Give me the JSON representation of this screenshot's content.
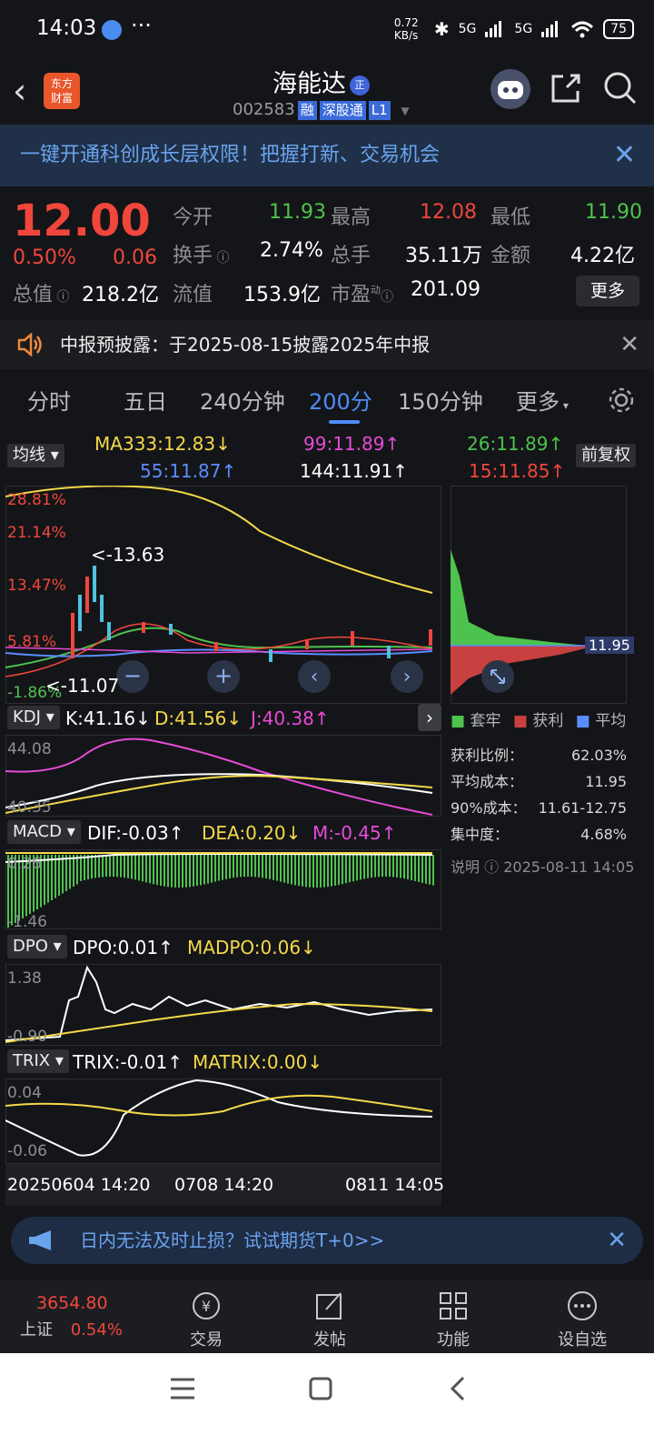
{
  "status": {
    "time": "14:03",
    "dots": "···",
    "net": "0.72 KB/s",
    "sig1": "5G",
    "sig2": "5G",
    "battery": "75"
  },
  "header": {
    "back": "‹",
    "logo_l1": "东方",
    "logo_l2": "财富",
    "name": "海能达",
    "badge": "正",
    "code": "002583",
    "tags": [
      "融",
      "深股通",
      "L1"
    ]
  },
  "banner": {
    "text": "一键开通科创成长层权限！把握打新、交易机会",
    "close": "✕"
  },
  "quote": {
    "price": "12.00",
    "pct": "0.50%",
    "change": "0.06",
    "open_l": "今开",
    "open": "11.93",
    "high_l": "最高",
    "high": "12.08",
    "low_l": "最低",
    "low": "11.90",
    "turn_l": "换手",
    "turn": "2.74%",
    "vol_l": "总手",
    "vol": "35.11万",
    "amt_l": "金额",
    "amt": "4.22亿",
    "mcap_l": "总值",
    "mcap": "218.2亿",
    "float_l": "流值",
    "float": "153.9亿",
    "pe_l": "市盈",
    "pe_sup": "动",
    "pe": "201.09",
    "more": "更多"
  },
  "notice": {
    "text": "中报预披露：于2025-08-15披露2025年中报",
    "close": "✕"
  },
  "tabs": {
    "items": [
      "分时",
      "五日",
      "240分钟",
      "200分",
      "150分钟",
      "更多"
    ],
    "active": "200分"
  },
  "main_chart": {
    "selector": "均线",
    "fq": "前复权",
    "ma333": "MA333:12.83↓",
    "ma99": "99:11.89↑",
    "ma26": "26:11.89↑",
    "ma55": "55:11.87↑",
    "ma144": "144:11.91↑",
    "ma15": "15:11.85↑",
    "y_labels": [
      "28.81%",
      "21.14%",
      "13.47%",
      "5.81%",
      "-1.86%"
    ],
    "peak_note": "<-13.63",
    "low_note": "<-11.07",
    "chip_price": "11.95"
  },
  "chip_panel": {
    "legend": [
      "套牢",
      "获利",
      "平均"
    ],
    "rows": [
      {
        "k": "获利比例：",
        "v": "62.03%"
      },
      {
        "k": "平均成本：",
        "v": "11.95"
      },
      {
        "k": "90%成本：",
        "v": "11.61-12.75"
      },
      {
        "k": "集中度：",
        "v": "4.68%"
      }
    ],
    "note_l": "说明",
    "note_time": "2025-08-11 14:05"
  },
  "kdj": {
    "name": "KDJ",
    "k": "K:41.16↓",
    "d": "D:41.56↓",
    "j": "J:40.38↑",
    "ymax": "44.08",
    "ymin": "40.35"
  },
  "macd": {
    "name": "MACD",
    "dif": "DIF:-0.03↑",
    "dea": "DEA:0.20↓",
    "m": "M:-0.45↑",
    "ymax": "0.26",
    "ymin": "-1.46"
  },
  "dpo": {
    "name": "DPO",
    "dpo": "DPO:0.01↑",
    "madpo": "MADPO:0.06↓",
    "ymax": "1.38",
    "ymin": "-0.90"
  },
  "trix": {
    "name": "TRIX",
    "trix": "TRIX:-0.01↑",
    "matrix": "MATRIX:0.00↓",
    "ymax": "0.04",
    "ymin": "-0.06"
  },
  "x_axis": [
    "20250604 14:20",
    "0708 14:20",
    "0811 14:05"
  ],
  "ad": {
    "text": "日内无法及时止损？试试期货T+0>>",
    "close": "✕"
  },
  "bottom": {
    "index_val": "3654.80",
    "index_name": "上证",
    "index_pct": "0.54%",
    "items": [
      "交易",
      "发帖",
      "功能",
      "设自选"
    ]
  },
  "colors": {
    "up": "#f0463c",
    "down": "#4ec24e",
    "accent": "#4d8cf5",
    "ma_yellow": "#f5d94a",
    "ma_magenta": "#e64bd6"
  }
}
